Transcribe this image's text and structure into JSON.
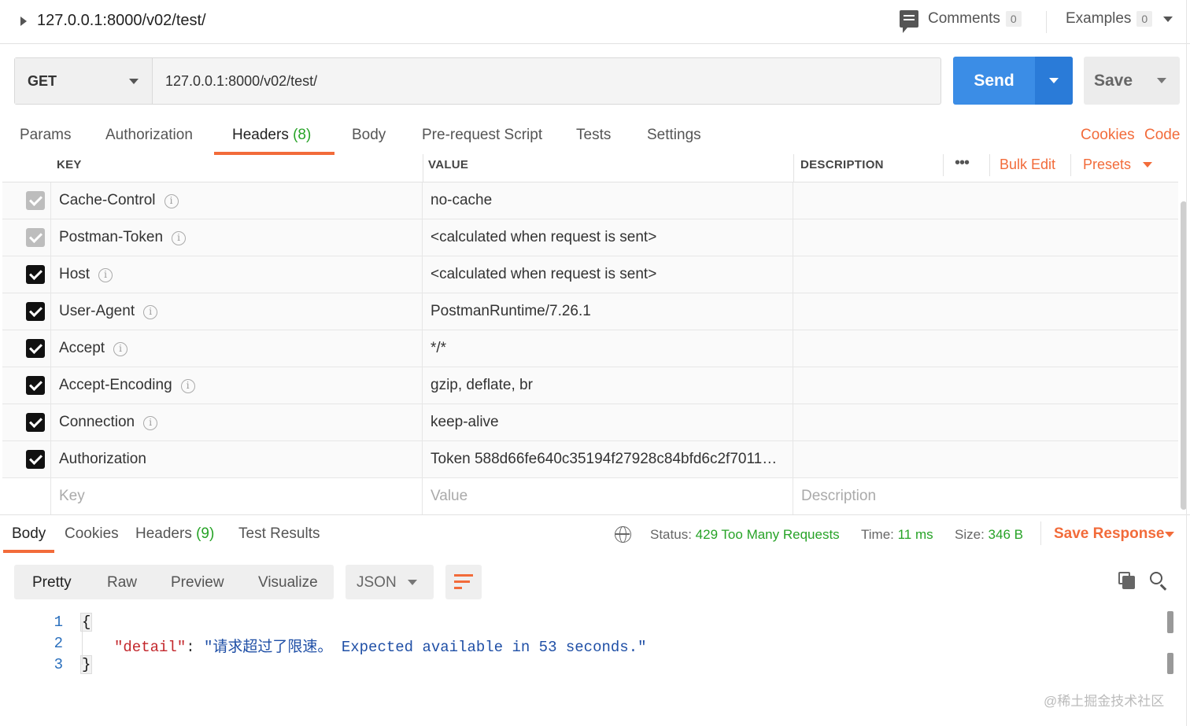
{
  "header": {
    "request_title": "127.0.0.1:8000/v02/test/",
    "comments_label": "Comments",
    "comments_count": "0",
    "examples_label": "Examples",
    "examples_count": "0"
  },
  "request": {
    "method": "GET",
    "url": "127.0.0.1:8000/v02/test/",
    "send_label": "Send",
    "save_label": "Save"
  },
  "tabs": {
    "params": "Params",
    "authorization": "Authorization",
    "headers": "Headers",
    "headers_count": "(8)",
    "body": "Body",
    "prerequest": "Pre-request Script",
    "tests": "Tests",
    "settings": "Settings",
    "cookies": "Cookies",
    "code": "Code"
  },
  "headers_table": {
    "col_key": "KEY",
    "col_value": "VALUE",
    "col_description": "DESCRIPTION",
    "more": "•••",
    "bulk_edit": "Bulk Edit",
    "presets": "Presets",
    "rows": [
      {
        "key": "Cache-Control",
        "value": "no-cache",
        "checked": true,
        "disabled": true
      },
      {
        "key": "Postman-Token",
        "value": "<calculated when request is sent>",
        "checked": true,
        "disabled": true
      },
      {
        "key": "Host",
        "value": "<calculated when request is sent>",
        "checked": true,
        "disabled": false
      },
      {
        "key": "User-Agent",
        "value": "PostmanRuntime/7.26.1",
        "checked": true,
        "disabled": false
      },
      {
        "key": "Accept",
        "value": "*/*",
        "checked": true,
        "disabled": false
      },
      {
        "key": "Accept-Encoding",
        "value": "gzip, deflate, br",
        "checked": true,
        "disabled": false
      },
      {
        "key": "Connection",
        "value": "keep-alive",
        "checked": true,
        "disabled": false
      },
      {
        "key": "Authorization",
        "value": "Token 588d66fe640c35194f27928c84bfd6c2f70116…",
        "checked": true,
        "disabled": false
      }
    ],
    "placeholder_key": "Key",
    "placeholder_value": "Value",
    "placeholder_description": "Description"
  },
  "response": {
    "tab_body": "Body",
    "tab_cookies": "Cookies",
    "tab_headers": "Headers",
    "tab_headers_count": "(9)",
    "tab_test_results": "Test Results",
    "status_label": "Status:",
    "status_value": "429 Too Many Requests",
    "time_label": "Time:",
    "time_value": "11 ms",
    "size_label": "Size:",
    "size_value": "346 B",
    "save_response": "Save Response",
    "formats": {
      "pretty": "Pretty",
      "raw": "Raw",
      "preview": "Preview",
      "visualize": "Visualize"
    },
    "language": "JSON",
    "code_lines": {
      "n1": "1",
      "n2": "2",
      "n3": "3",
      "open": "{",
      "key": "\"detail\"",
      "colon": ": ",
      "value": "\"请求超过了限速。 Expected available in 53 seconds.\"",
      "close": "}"
    }
  },
  "watermark": "@稀土掘金技术社区"
}
